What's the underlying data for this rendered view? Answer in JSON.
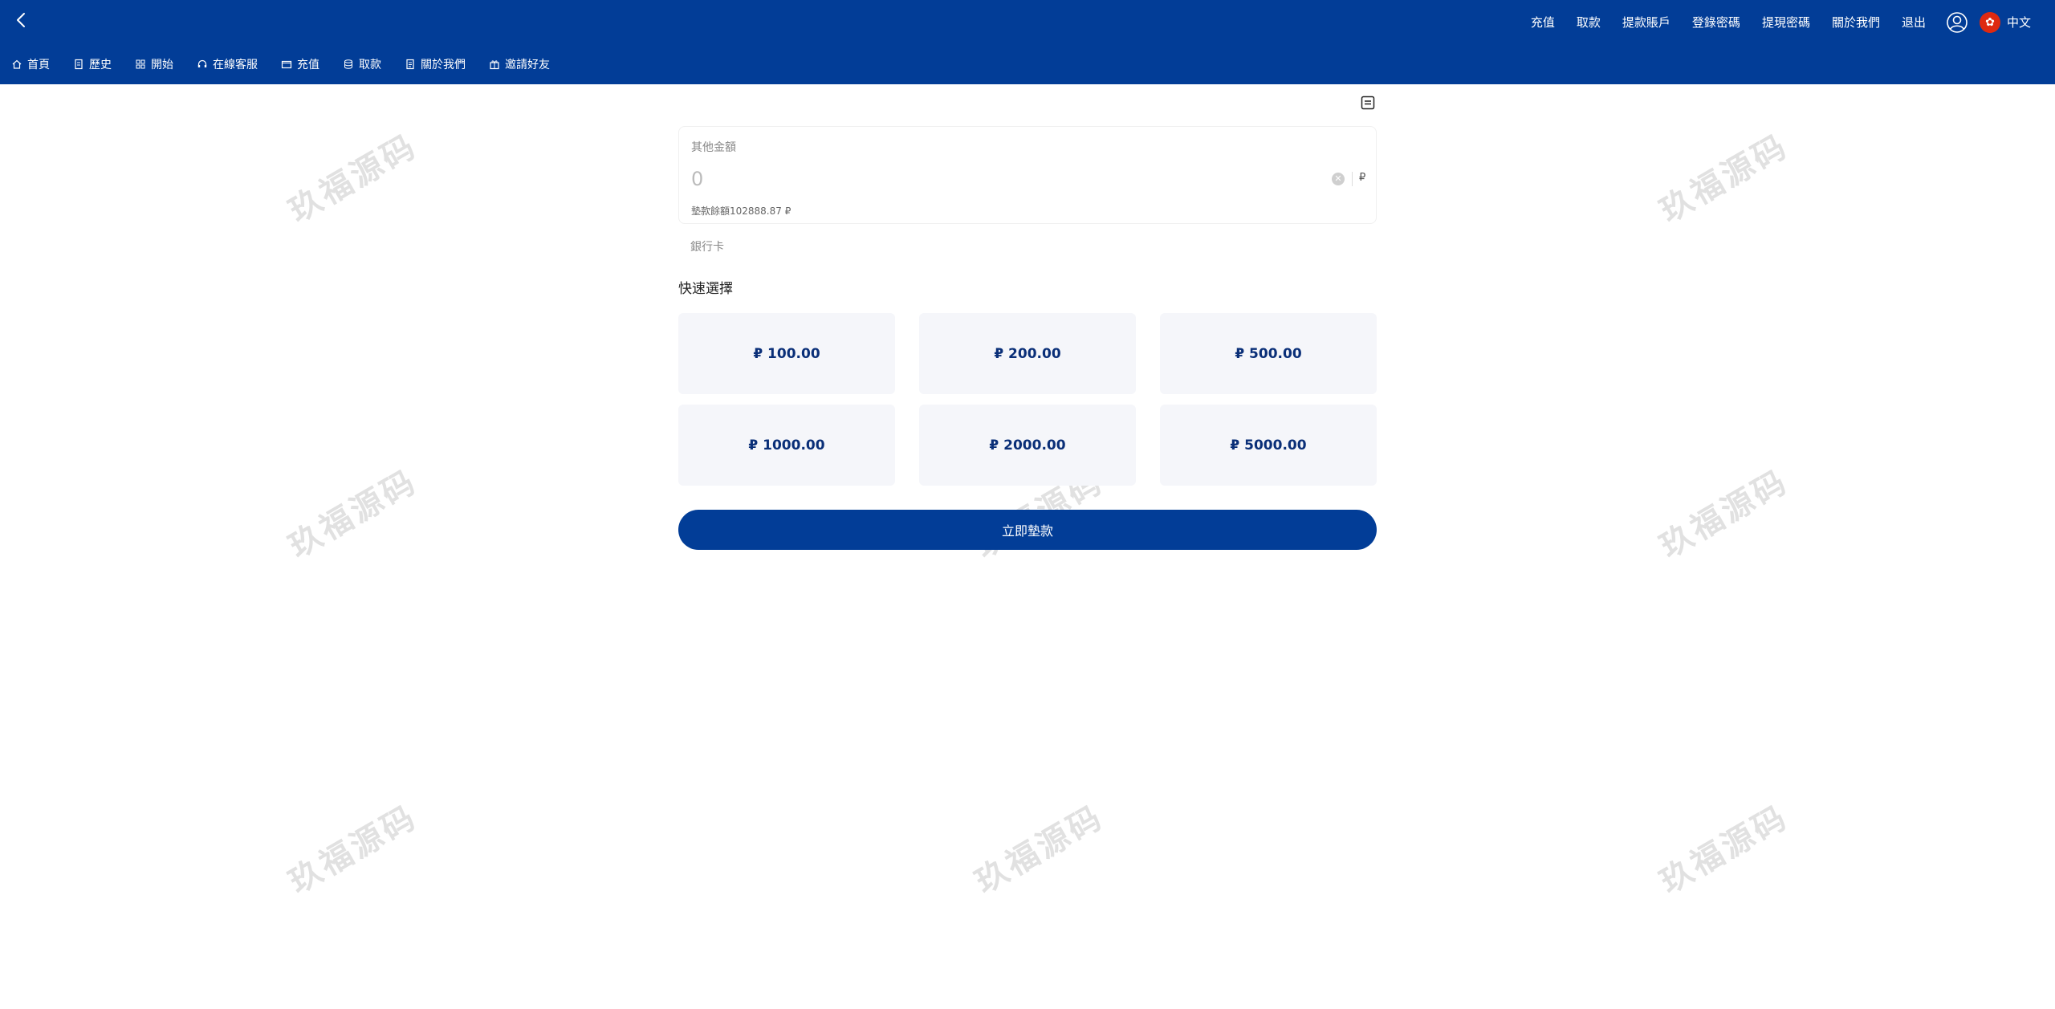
{
  "header": {
    "top_links": [
      "充值",
      "取款",
      "提款賬戶",
      "登錄密碼",
      "提現密碼",
      "關於我們",
      "退出"
    ],
    "language": "中文"
  },
  "subnav": [
    {
      "icon": "home-icon",
      "label": "首頁"
    },
    {
      "icon": "history-icon",
      "label": "歷史"
    },
    {
      "icon": "grid-icon",
      "label": "開始"
    },
    {
      "icon": "headset-icon",
      "label": "在線客服"
    },
    {
      "icon": "wallet-icon",
      "label": "充值"
    },
    {
      "icon": "coins-icon",
      "label": "取款"
    },
    {
      "icon": "document-icon",
      "label": "關於我們"
    },
    {
      "icon": "gift-icon",
      "label": "邀請好友"
    }
  ],
  "form": {
    "amount_label": "其他金額",
    "amount_placeholder": "0",
    "currency_symbol": "₽",
    "balance_text": "墊款餘額102888.87 ₽",
    "bank_label": "銀行卡",
    "quick_title": "快速選擇",
    "quick_amounts": [
      "₽ 100.00",
      "₽ 200.00",
      "₽ 500.00",
      "₽ 1000.00",
      "₽ 2000.00",
      "₽ 5000.00"
    ],
    "submit_label": "立即墊款"
  },
  "watermark": "玖福源码",
  "colors": {
    "primary": "#023d97",
    "tile_bg": "#f5f6fa",
    "tile_text": "#0a2f78"
  }
}
